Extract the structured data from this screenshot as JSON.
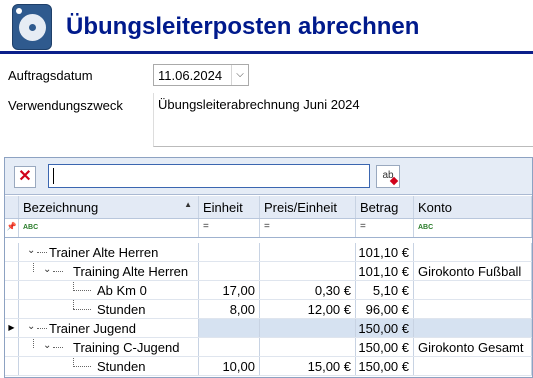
{
  "header": {
    "title": "Übungsleiterposten abrechnen",
    "icon": "disk-icon"
  },
  "form": {
    "date_label": "Auftragsdatum",
    "date_value": "11.06.2024",
    "purpose_label": "Verwendungszweck",
    "purpose_value": "Übungsleiterabrechnung Juni 2024"
  },
  "grid": {
    "columns": [
      "Bezeichnung",
      "Einheit",
      "Preis/Einheit",
      "Betrag",
      "Konto"
    ],
    "filter_eq": "=",
    "abc": "ABC",
    "rows": [
      {
        "label": "Trainer Alte Herren",
        "einheit": "",
        "preis": "",
        "betrag": "101,10 €",
        "konto": ""
      },
      {
        "label": "Training Alte Herren",
        "einheit": "",
        "preis": "",
        "betrag": "101,10 €",
        "konto": "Girokonto Fußball"
      },
      {
        "label": "Ab Km 0",
        "einheit": "17,00",
        "preis": "0,30 €",
        "betrag": "5,10 €",
        "konto": ""
      },
      {
        "label": "Stunden",
        "einheit": "8,00",
        "preis": "12,00 €",
        "betrag": "96,00 €",
        "konto": ""
      },
      {
        "label": "Trainer Jugend",
        "einheit": "",
        "preis": "",
        "betrag": "150,00 €",
        "konto": ""
      },
      {
        "label": "Training C-Jugend",
        "einheit": "",
        "preis": "",
        "betrag": "150,00 €",
        "konto": "Girokonto Gesamt"
      },
      {
        "label": "Stunden",
        "einheit": "10,00",
        "preis": "15,00 €",
        "betrag": "150,00 €",
        "konto": ""
      }
    ]
  },
  "colors": {
    "title": "#001a8c",
    "selection": "#d6e2f1",
    "header_bg": "#e3eaf5"
  }
}
